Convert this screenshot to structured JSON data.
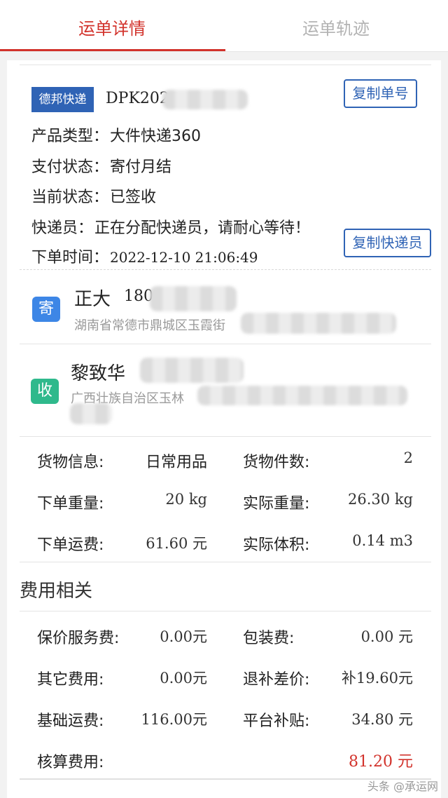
{
  "tabs": {
    "detail": "运单详情",
    "track": "运单轨迹"
  },
  "waybill": {
    "carrier": "德邦快递",
    "number_visible": "DPK202",
    "copy_number_button": "复制单号",
    "copy_courier_button": "复制快递员",
    "product_type_label": "产品类型：",
    "product_type_value": "大件快递360",
    "payment_status_label": "支付状态：",
    "payment_status_value": "寄付月结",
    "current_status_label": "当前状态：",
    "current_status_value": "已签收",
    "courier_label": "快递员：",
    "courier_value": "正在分配快递员，请耐心等待！",
    "order_time_label": "下单时间：",
    "order_time_value": "2022-12-10 21:06:49"
  },
  "sender": {
    "icon_text": "寄",
    "icon_color": "#3d86e6",
    "name": "正大",
    "phone_visible": "180",
    "address_visible": "湖南省常德市鼎城区玉霞街"
  },
  "receiver": {
    "icon_text": "收",
    "icon_color": "#2fb98c",
    "name": "黎致华",
    "address_visible": "广西壮族自治区玉林"
  },
  "cargo": {
    "goods_info_label": "货物信息:",
    "goods_info_value": "日常用品",
    "piece_count_label": "货物件数:",
    "piece_count_value": "2",
    "order_weight_label": "下单重量:",
    "order_weight_value": "20 kg",
    "actual_weight_label": "实际重量:",
    "actual_weight_value": "26.30 kg",
    "order_fee_label": "下单运费:",
    "order_fee_value": "61.60 元",
    "actual_volume_label": "实际体积:",
    "actual_volume_value": "0.14 m3"
  },
  "fees": {
    "section_title": "费用相关",
    "insurance_label": "保价服务费:",
    "insurance_value": "0.00元",
    "packaging_label": "包装费:",
    "packaging_value": "0.00 元",
    "other_label": "其它费用:",
    "other_value": "0.00元",
    "refund_diff_label": "退补差价:",
    "refund_diff_value": "补19.60元",
    "base_label": "基础运费:",
    "base_value": "116.00元",
    "subsidy_label": "平台补贴:",
    "subsidy_value": "34.80 元",
    "settled_label": "核算费用:",
    "settled_value": "81.20 元",
    "settled_color": "#d2322b"
  },
  "watermark": "头条 @承运网",
  "colors": {
    "accent": "#d2322b",
    "brand_blue": "#2f63b5"
  }
}
